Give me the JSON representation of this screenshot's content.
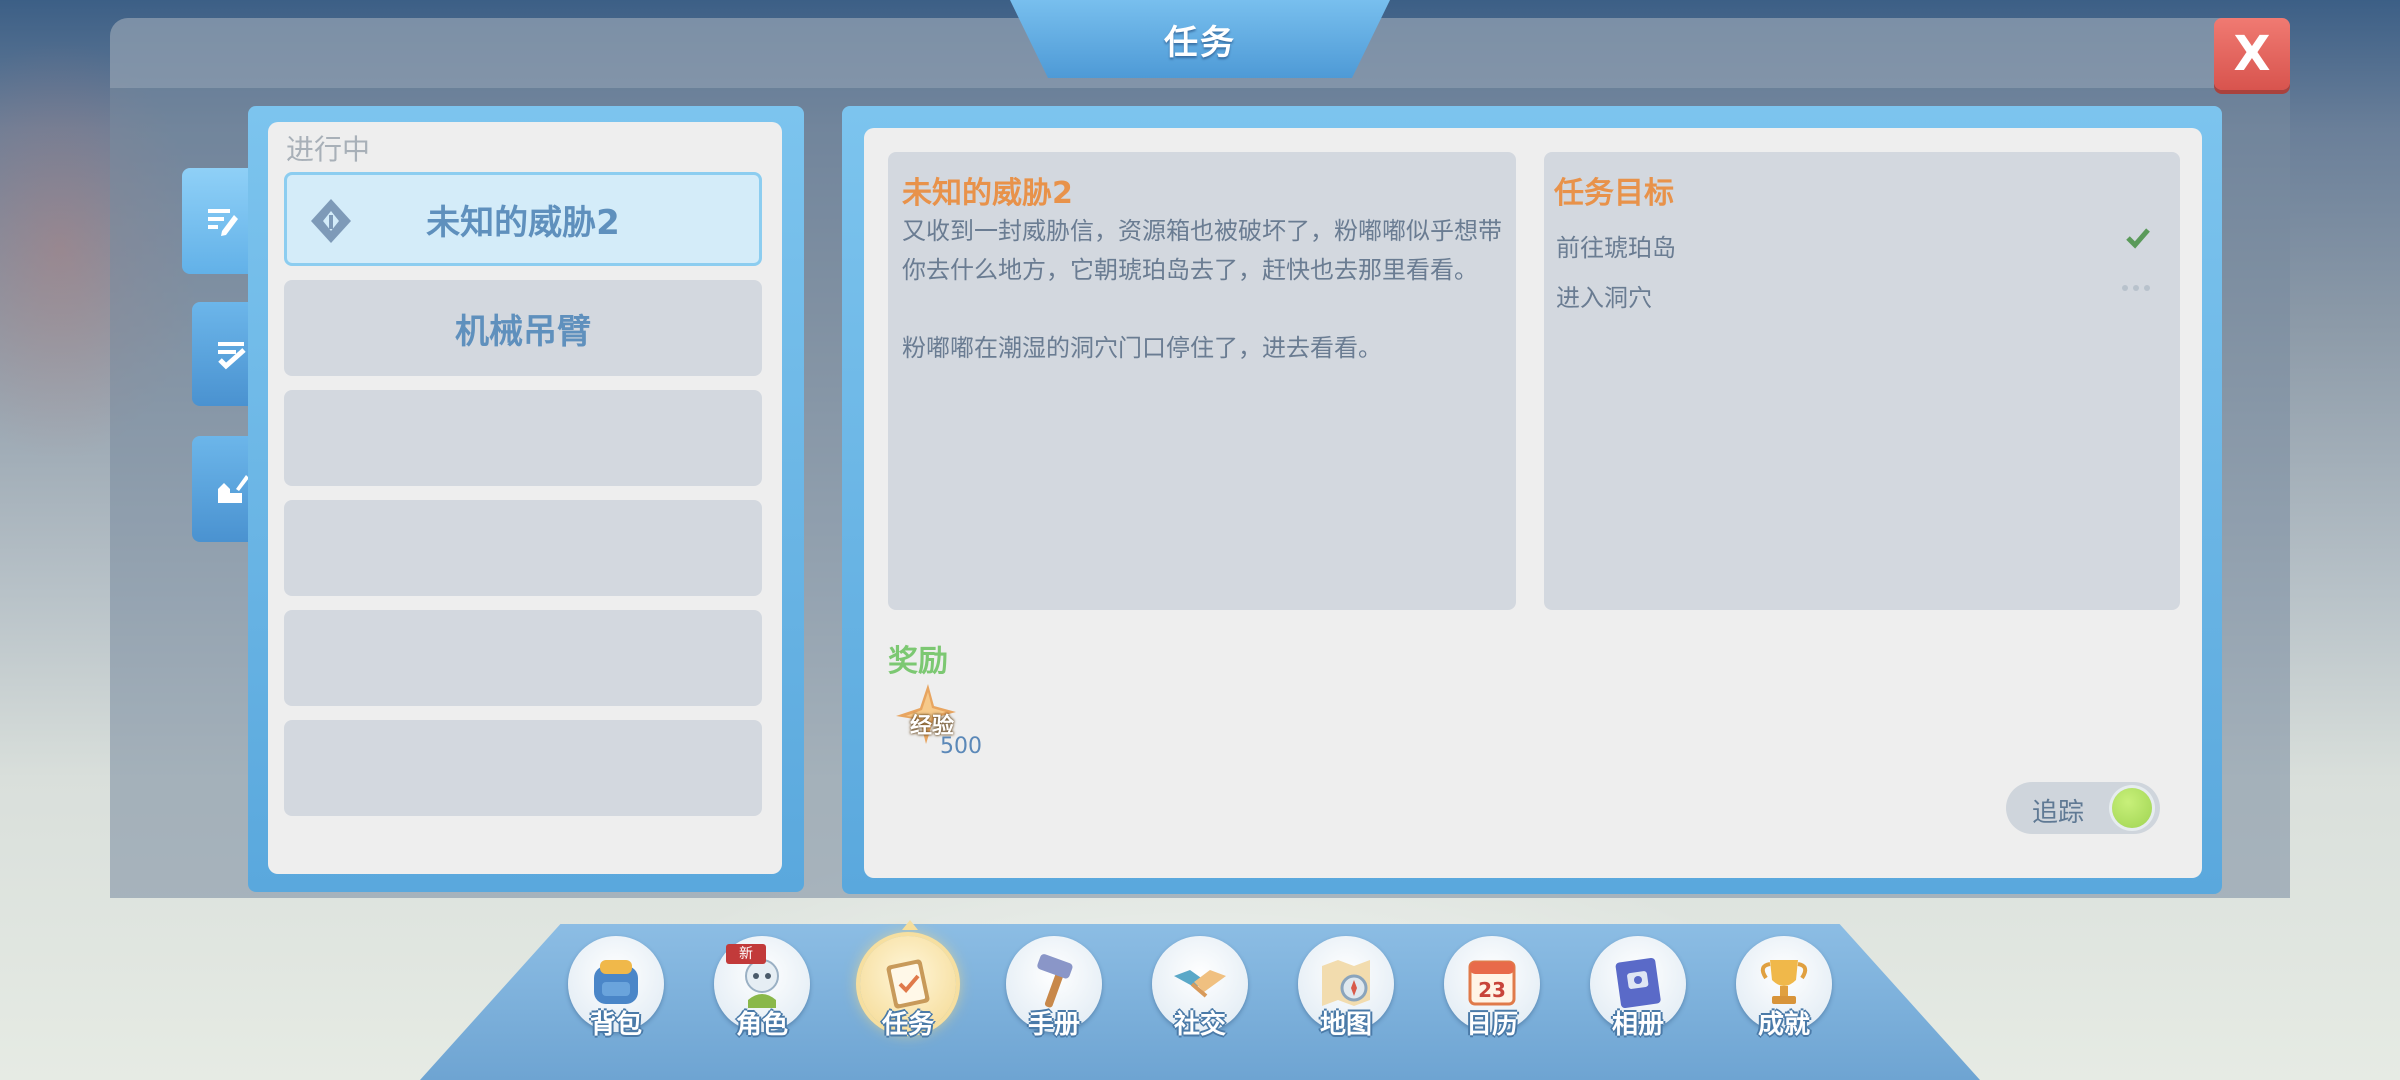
{
  "window": {
    "title": "任务",
    "close_label": "X"
  },
  "quest_list": {
    "section_label": "进行中",
    "items": [
      {
        "label": "未知的威胁2",
        "selected": true
      },
      {
        "label": "机械吊臂",
        "selected": false
      },
      {
        "label": "",
        "selected": false
      },
      {
        "label": "",
        "selected": false
      },
      {
        "label": "",
        "selected": false
      },
      {
        "label": "",
        "selected": false
      }
    ]
  },
  "side_tabs": [
    {
      "icon": "quest-edit-icon",
      "active": true
    },
    {
      "icon": "quest-check-icon",
      "active": false
    },
    {
      "icon": "building-edit-icon",
      "active": false
    }
  ],
  "quest_detail": {
    "title": "未知的威胁2",
    "description": "又收到一封威胁信，资源箱也被破坏了，粉嘟嘟似乎想带你去什么地方，它朝琥珀岛去了，赶快也去那里看看。\n\n粉嘟嘟在潮湿的洞穴门口停住了，进去看看。",
    "goals_title": "任务目标",
    "goals": [
      {
        "label": "前往琥珀岛",
        "status": "done"
      },
      {
        "label": "进入洞穴",
        "status": "pending"
      }
    ],
    "reward_title": "奖励",
    "rewards": [
      {
        "label": "经验",
        "value": "500",
        "icon": "exp-star-icon"
      }
    ],
    "track_label": "追踪",
    "track_enabled": true
  },
  "nav": {
    "items": [
      {
        "label": "背包",
        "icon": "backpack-icon",
        "active": false,
        "badge": ""
      },
      {
        "label": "角色",
        "icon": "character-icon",
        "active": false,
        "badge": "新"
      },
      {
        "label": "任务",
        "icon": "quest-clipboard-icon",
        "active": true,
        "badge": ""
      },
      {
        "label": "手册",
        "icon": "hammer-icon",
        "active": false,
        "badge": ""
      },
      {
        "label": "社交",
        "icon": "handshake-icon",
        "active": false,
        "badge": ""
      },
      {
        "label": "地图",
        "icon": "map-compass-icon",
        "active": false,
        "badge": ""
      },
      {
        "label": "日历",
        "icon": "calendar-icon",
        "active": false,
        "badge": ""
      },
      {
        "label": "相册",
        "icon": "album-icon",
        "active": false,
        "badge": ""
      },
      {
        "label": "成就",
        "icon": "trophy-icon",
        "active": false,
        "badge": ""
      }
    ]
  },
  "colors": {
    "accent_blue": "#5aa8dd",
    "title_orange": "#e8924a",
    "reward_green": "#7cc872",
    "close_red": "#d8544e"
  }
}
